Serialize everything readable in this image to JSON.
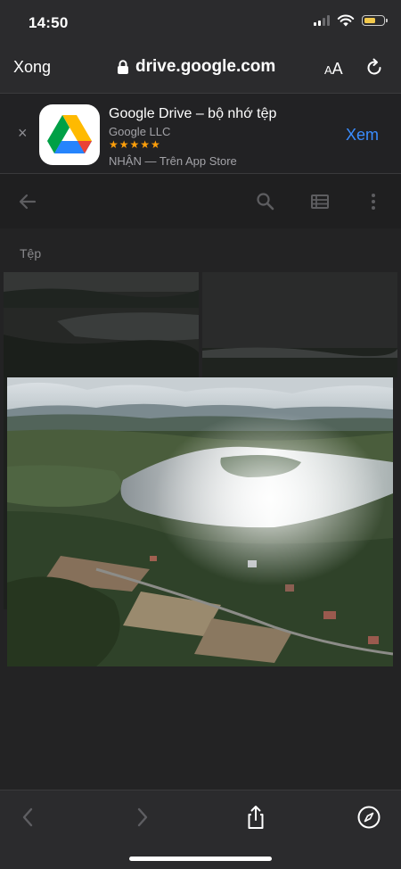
{
  "status_bar": {
    "time": "14:50",
    "battery_color": "#f2c94c"
  },
  "address_bar": {
    "done_label": "Xong",
    "url": "drive.google.com",
    "text_size_small": "A",
    "text_size_large": "A",
    "reload_icon": "reload-icon",
    "lock_icon": "lock-icon"
  },
  "app_banner": {
    "close_symbol": "×",
    "app_name": "Google Drive – bộ nhớ tệp",
    "developer": "Google LLC",
    "stars": "★★★★★",
    "store_line": "NHẬN — Trên App Store",
    "view_label": "Xem",
    "accent_color": "#3a8dff"
  },
  "drive_toolbar": {
    "icons": [
      "back-arrow-icon",
      "search-icon",
      "list-view-icon",
      "more-vert-icon"
    ]
  },
  "content": {
    "section_label": "Tệp"
  },
  "bottom_bar": {
    "icons": [
      "back-chevron-icon",
      "forward-chevron-icon",
      "share-icon",
      "compass-icon"
    ]
  }
}
